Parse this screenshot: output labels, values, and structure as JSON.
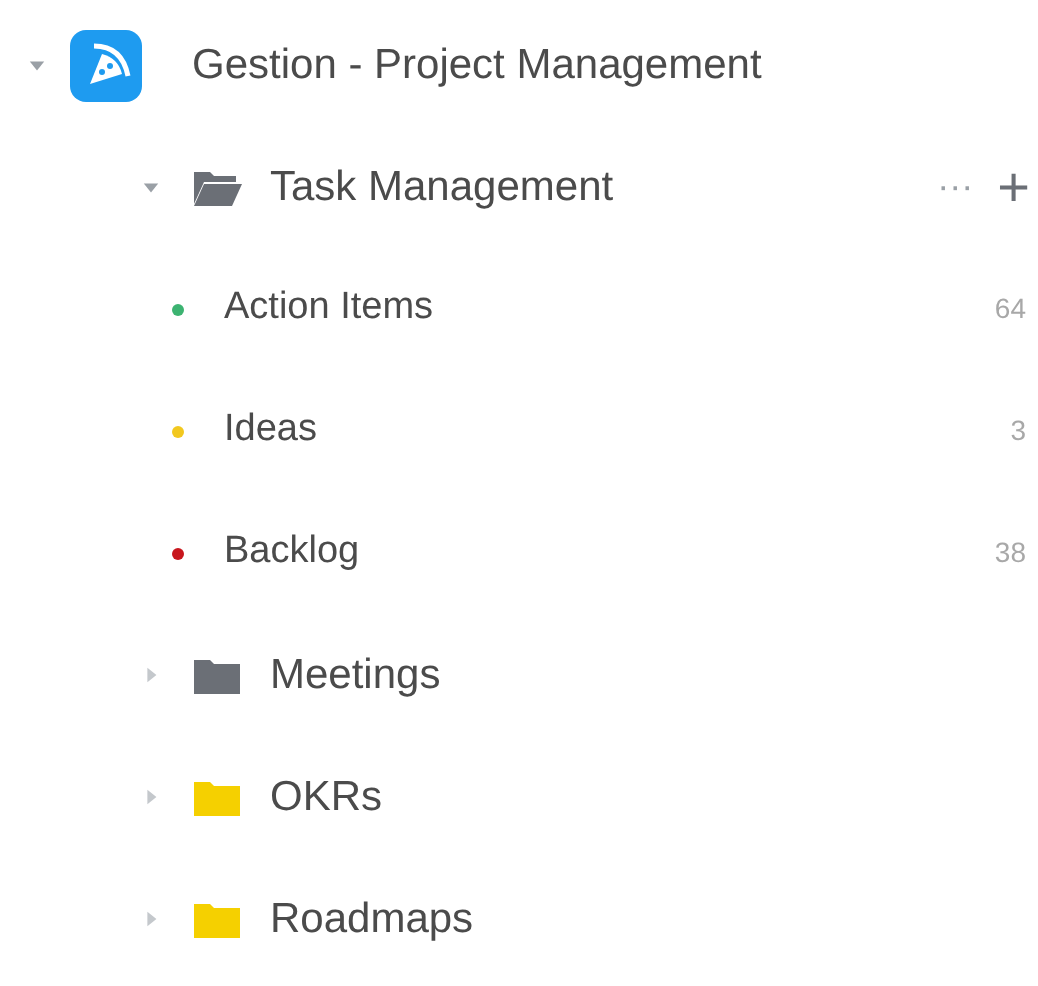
{
  "space": {
    "name": "Gestion - Project Management",
    "expanded": true,
    "folders": [
      {
        "name": "Task Management",
        "expanded": true,
        "color": "#6b6f76",
        "actions": {
          "more": "···",
          "add": "+"
        },
        "lists": [
          {
            "name": "Action Items",
            "color": "#3cb371",
            "count": "64"
          },
          {
            "name": "Ideas",
            "color": "#f2c81f",
            "count": "3"
          },
          {
            "name": "Backlog",
            "color": "#c8161d",
            "count": "38"
          }
        ]
      },
      {
        "name": "Meetings",
        "expanded": false,
        "color": "#6b6f76"
      },
      {
        "name": "OKRs",
        "expanded": false,
        "color": "#f5d000"
      },
      {
        "name": "Roadmaps",
        "expanded": false,
        "color": "#f5d000"
      }
    ]
  }
}
